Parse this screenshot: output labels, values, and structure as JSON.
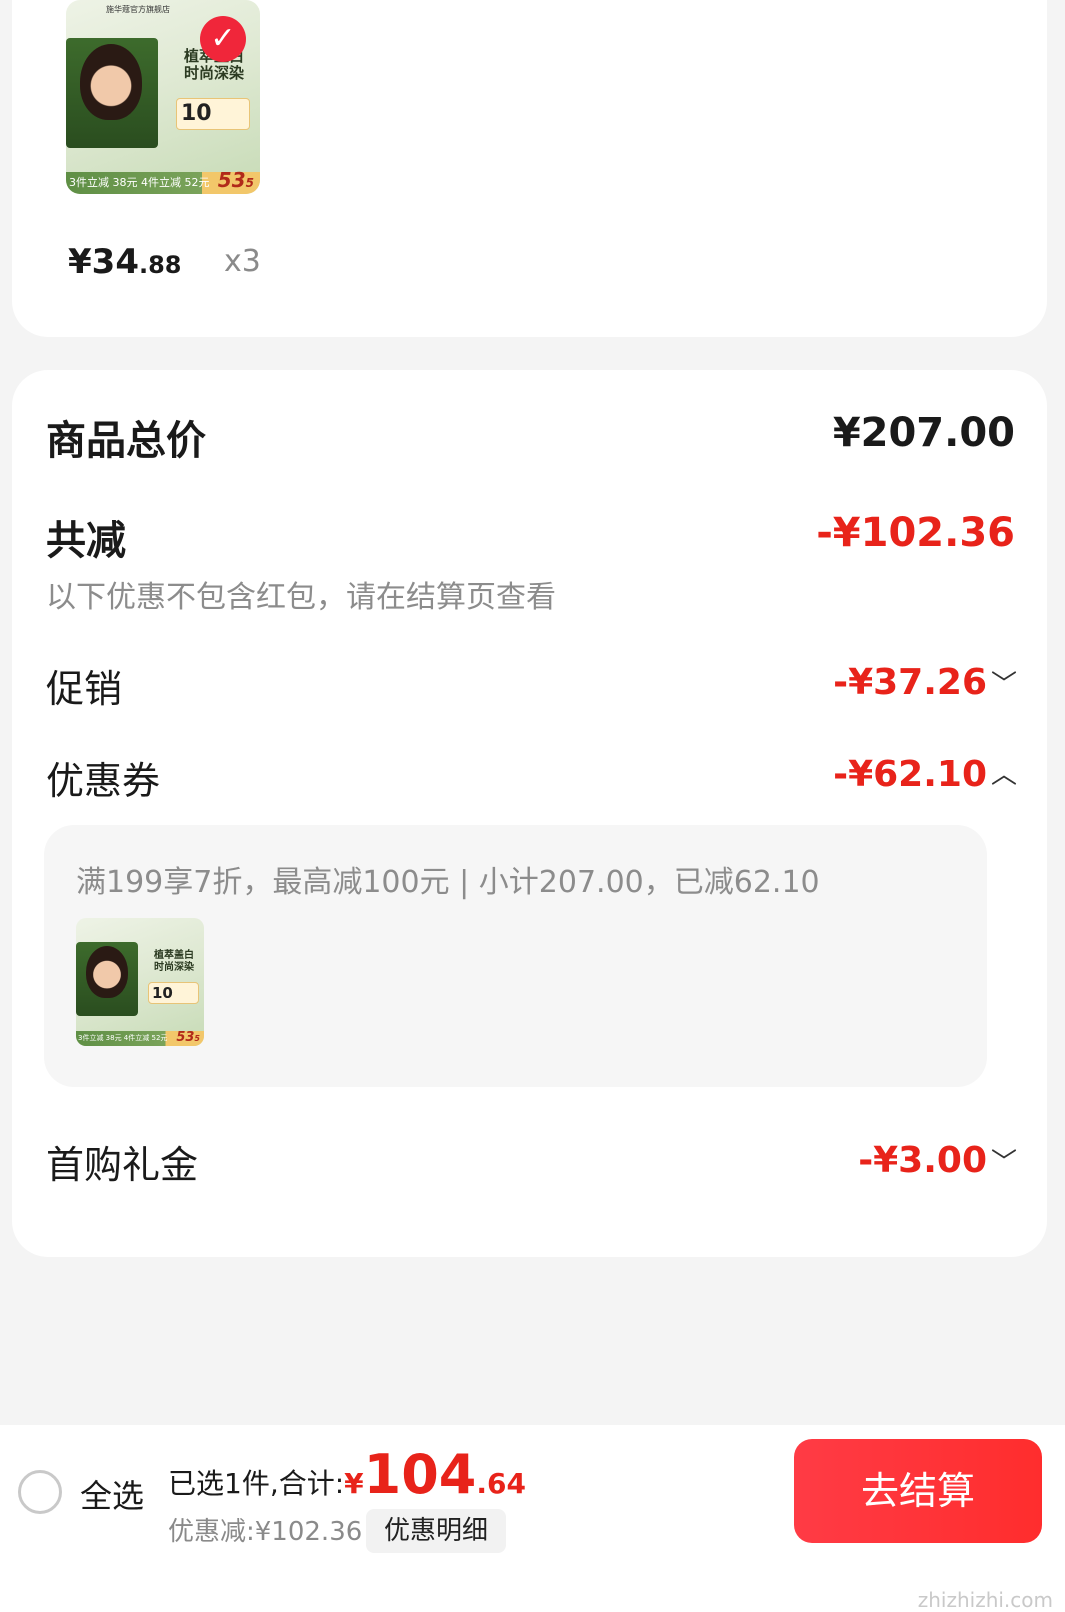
{
  "item": {
    "price_main": "¥34",
    "price_decimal": ".88",
    "quantity": "x3",
    "thumb": {
      "store": "施华蔻官方旗舰店",
      "title_line1": "植萃盖白",
      "title_line2": "时尚深染",
      "coupon_num": "10",
      "promo": "3件立减 38元 4件立减 52元",
      "price_big": "53",
      "price_small": "5"
    }
  },
  "summary": {
    "total_label": "商品总价",
    "total_value": "¥207.00",
    "discount_label": "共减",
    "discount_value": "-¥102.36",
    "discount_note": "以下优惠不包含红包，请在结算页查看",
    "promo_label": "促销",
    "promo_value": "-¥37.26",
    "coupon_label": "优惠券",
    "coupon_value": "-¥62.10",
    "coupon_detail": "满199享7折，最高减100元 | 小计207.00，已减62.10",
    "first_label": "首购礼金",
    "first_value": "-¥3.00"
  },
  "bottom": {
    "select_all": "全选",
    "selected_text": "已选1件,合计:",
    "currency": "¥",
    "total_int": "104",
    "total_dec": ".64",
    "saved_text": "优惠减:¥102.36",
    "detail_button": "优惠明细",
    "checkout_button": "去结算",
    "watermark": "值值值",
    "watermark_url": "zhizhizhi.com"
  },
  "colors": {
    "accent_red": "#e8231a",
    "checkout_start": "#ff3b45",
    "checkout_end": "#ff2d2d"
  },
  "icons": [
    "check-icon",
    "chevron-down-icon",
    "chevron-up-icon",
    "radio-icon"
  ]
}
